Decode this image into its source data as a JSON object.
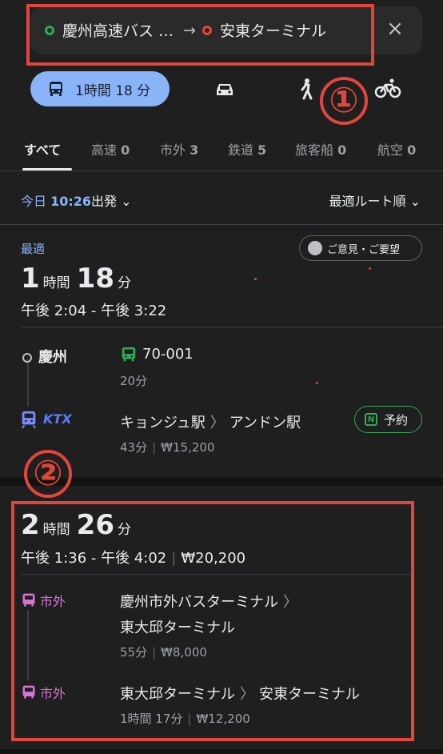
{
  "search": {
    "origin": "慶州高速バス …",
    "arrow": "→",
    "destination": "安東ターミナル",
    "close": "×"
  },
  "annotations": {
    "one": "①",
    "two": "②"
  },
  "modes": {
    "transit_label": "1時間 18 分",
    "items": [
      "transit-icon",
      "car-icon",
      "walk-icon",
      "bike-icon"
    ]
  },
  "tabs": [
    {
      "label": "すべて"
    },
    {
      "label": "高速",
      "count": "0"
    },
    {
      "label": "市外",
      "count": "3"
    },
    {
      "label": "鉄道",
      "count": "5"
    },
    {
      "label": "旅客船",
      "count": "0"
    },
    {
      "label": "航空",
      "count": "0"
    }
  ],
  "depart": {
    "day": "今日",
    "time": "10:26",
    "suffix": "出発"
  },
  "sort": {
    "label": "最適ルート順"
  },
  "route1": {
    "badge": "最適",
    "feedback": "ご意見・ご要望",
    "hours": "1",
    "hours_unit": "時間",
    "minutes": "18",
    "minutes_unit": "分",
    "times": "午後 2:04 - 午後 3:22",
    "legs": [
      {
        "origin": "慶州",
        "line": "70-001",
        "sub": "20分"
      },
      {
        "mode": "KTX",
        "from": "キョンジュ駅",
        "to": "アンドン駅",
        "duration": "43分",
        "fare": "₩15,200",
        "reserve": "予約",
        "reserve_icon": "N"
      }
    ]
  },
  "route2": {
    "hours": "2",
    "hours_unit": "時間",
    "minutes": "26",
    "minutes_unit": "分",
    "times": "午後 1:36 - 午後 4:02",
    "fare": "₩20,200",
    "legs": [
      {
        "mode": "市外",
        "from": "慶州市外バスターミナル",
        "to": "東大邱ターミナル",
        "duration": "55分",
        "fare": "₩8,000"
      },
      {
        "mode": "市外",
        "from": "東大邱ターミナル",
        "to": "安東ターミナル",
        "duration": "1時間 17分",
        "fare": "₩12,200"
      }
    ]
  },
  "colors": {
    "accent": "#8ab4f8",
    "green": "#34a853",
    "pink": "#d674d6",
    "annotation": "#e0463c",
    "background": "#1f1f1f"
  }
}
